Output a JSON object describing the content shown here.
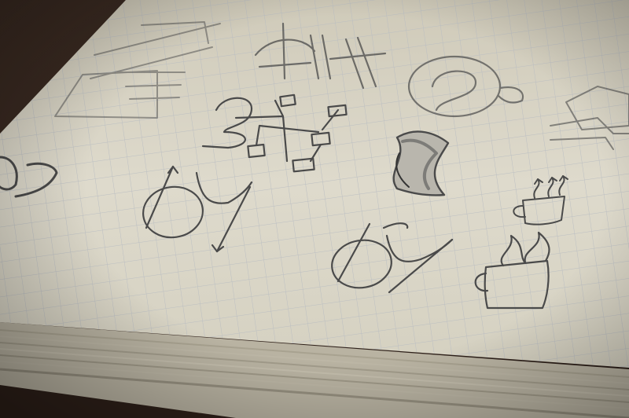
{
  "scene": {
    "subject": "notebook-sketches",
    "palette": {
      "table": "#3b2b22",
      "table_dark": "#2a1d17",
      "paper": "#dcd7c8",
      "paper_light": "#e6e2d5",
      "grid": "#b9bdc2",
      "pencil": "#4a4a4a",
      "page_edges": "#c9c3b2"
    },
    "sketches": [
      "fork-diagram-icon",
      "circle-link-icon",
      "flowchart-nodes-icon",
      "bacon-strip-icon",
      "b-y-ligature-sketch",
      "coffee-cup-icon"
    ]
  }
}
